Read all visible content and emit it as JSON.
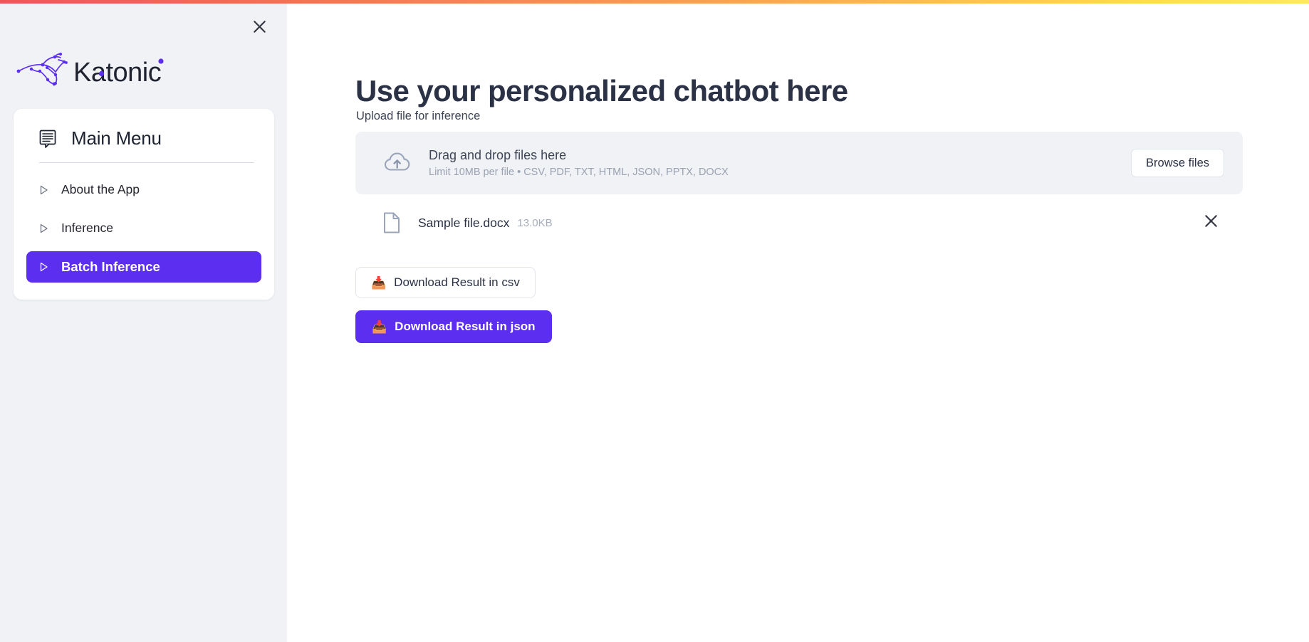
{
  "window": {
    "top_bar_gradient_from": "#f2545b",
    "top_bar_gradient_to": "#ffe95c",
    "accent_color": "#5b2ef0",
    "sidebar_bg": "#f0f2f6"
  },
  "sidebar": {
    "close_icon": "close-icon",
    "brand": "Katonic",
    "menu": {
      "icon": "menu-board-icon",
      "title": "Main Menu",
      "items": [
        {
          "label": "About the App",
          "icon": "triangle-right-icon",
          "active": false
        },
        {
          "label": "Inference",
          "icon": "triangle-right-icon",
          "active": false
        },
        {
          "label": "Batch Inference",
          "icon": "triangle-right-icon",
          "active": true
        }
      ]
    }
  },
  "main": {
    "title": "Use your personalized chatbot here",
    "upload_label": "Upload file for inference",
    "dropzone": {
      "icon": "cloud-upload-icon",
      "title": "Drag and drop files here",
      "subtitle": "Limit 10MB per file • CSV, PDF, TXT, HTML, JSON, PPTX, DOCX",
      "browse_label": "Browse files"
    },
    "file": {
      "icon": "file-document-icon",
      "name": "Sample file.docx",
      "size": "13.0KB",
      "remove_icon": "close-icon"
    },
    "actions": [
      {
        "label": "Download Result in csv",
        "emoji": "📥",
        "style": "secondary"
      },
      {
        "label": "Download Result in json",
        "emoji": "📥",
        "style": "primary"
      }
    ]
  }
}
